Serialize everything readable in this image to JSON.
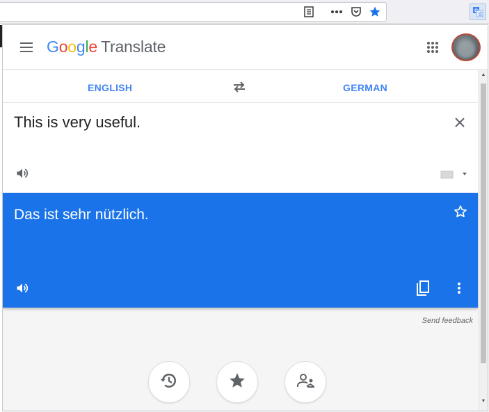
{
  "browser": {
    "icons": [
      "reader-view-icon",
      "more-actions-icon",
      "pocket-icon",
      "bookmark-star-icon",
      "translate-extension-icon"
    ]
  },
  "header": {
    "logo_letters": [
      "G",
      "o",
      "o",
      "g",
      "l",
      "e"
    ],
    "logo_colors": [
      "#4285f4",
      "#ea4335",
      "#fbbc05",
      "#4285f4",
      "#34a853",
      "#ea4335"
    ],
    "product": "Translate"
  },
  "languages": {
    "source": "ENGLISH",
    "target": "GERMAN",
    "accent": "#4285f4"
  },
  "source": {
    "text": "This is very useful."
  },
  "result": {
    "text": "Das ist sehr nützlich.",
    "background": "#1a73e8"
  },
  "footer": {
    "feedback": "Send feedback",
    "buttons": [
      "history-icon",
      "saved-star-icon",
      "community-icon"
    ]
  }
}
